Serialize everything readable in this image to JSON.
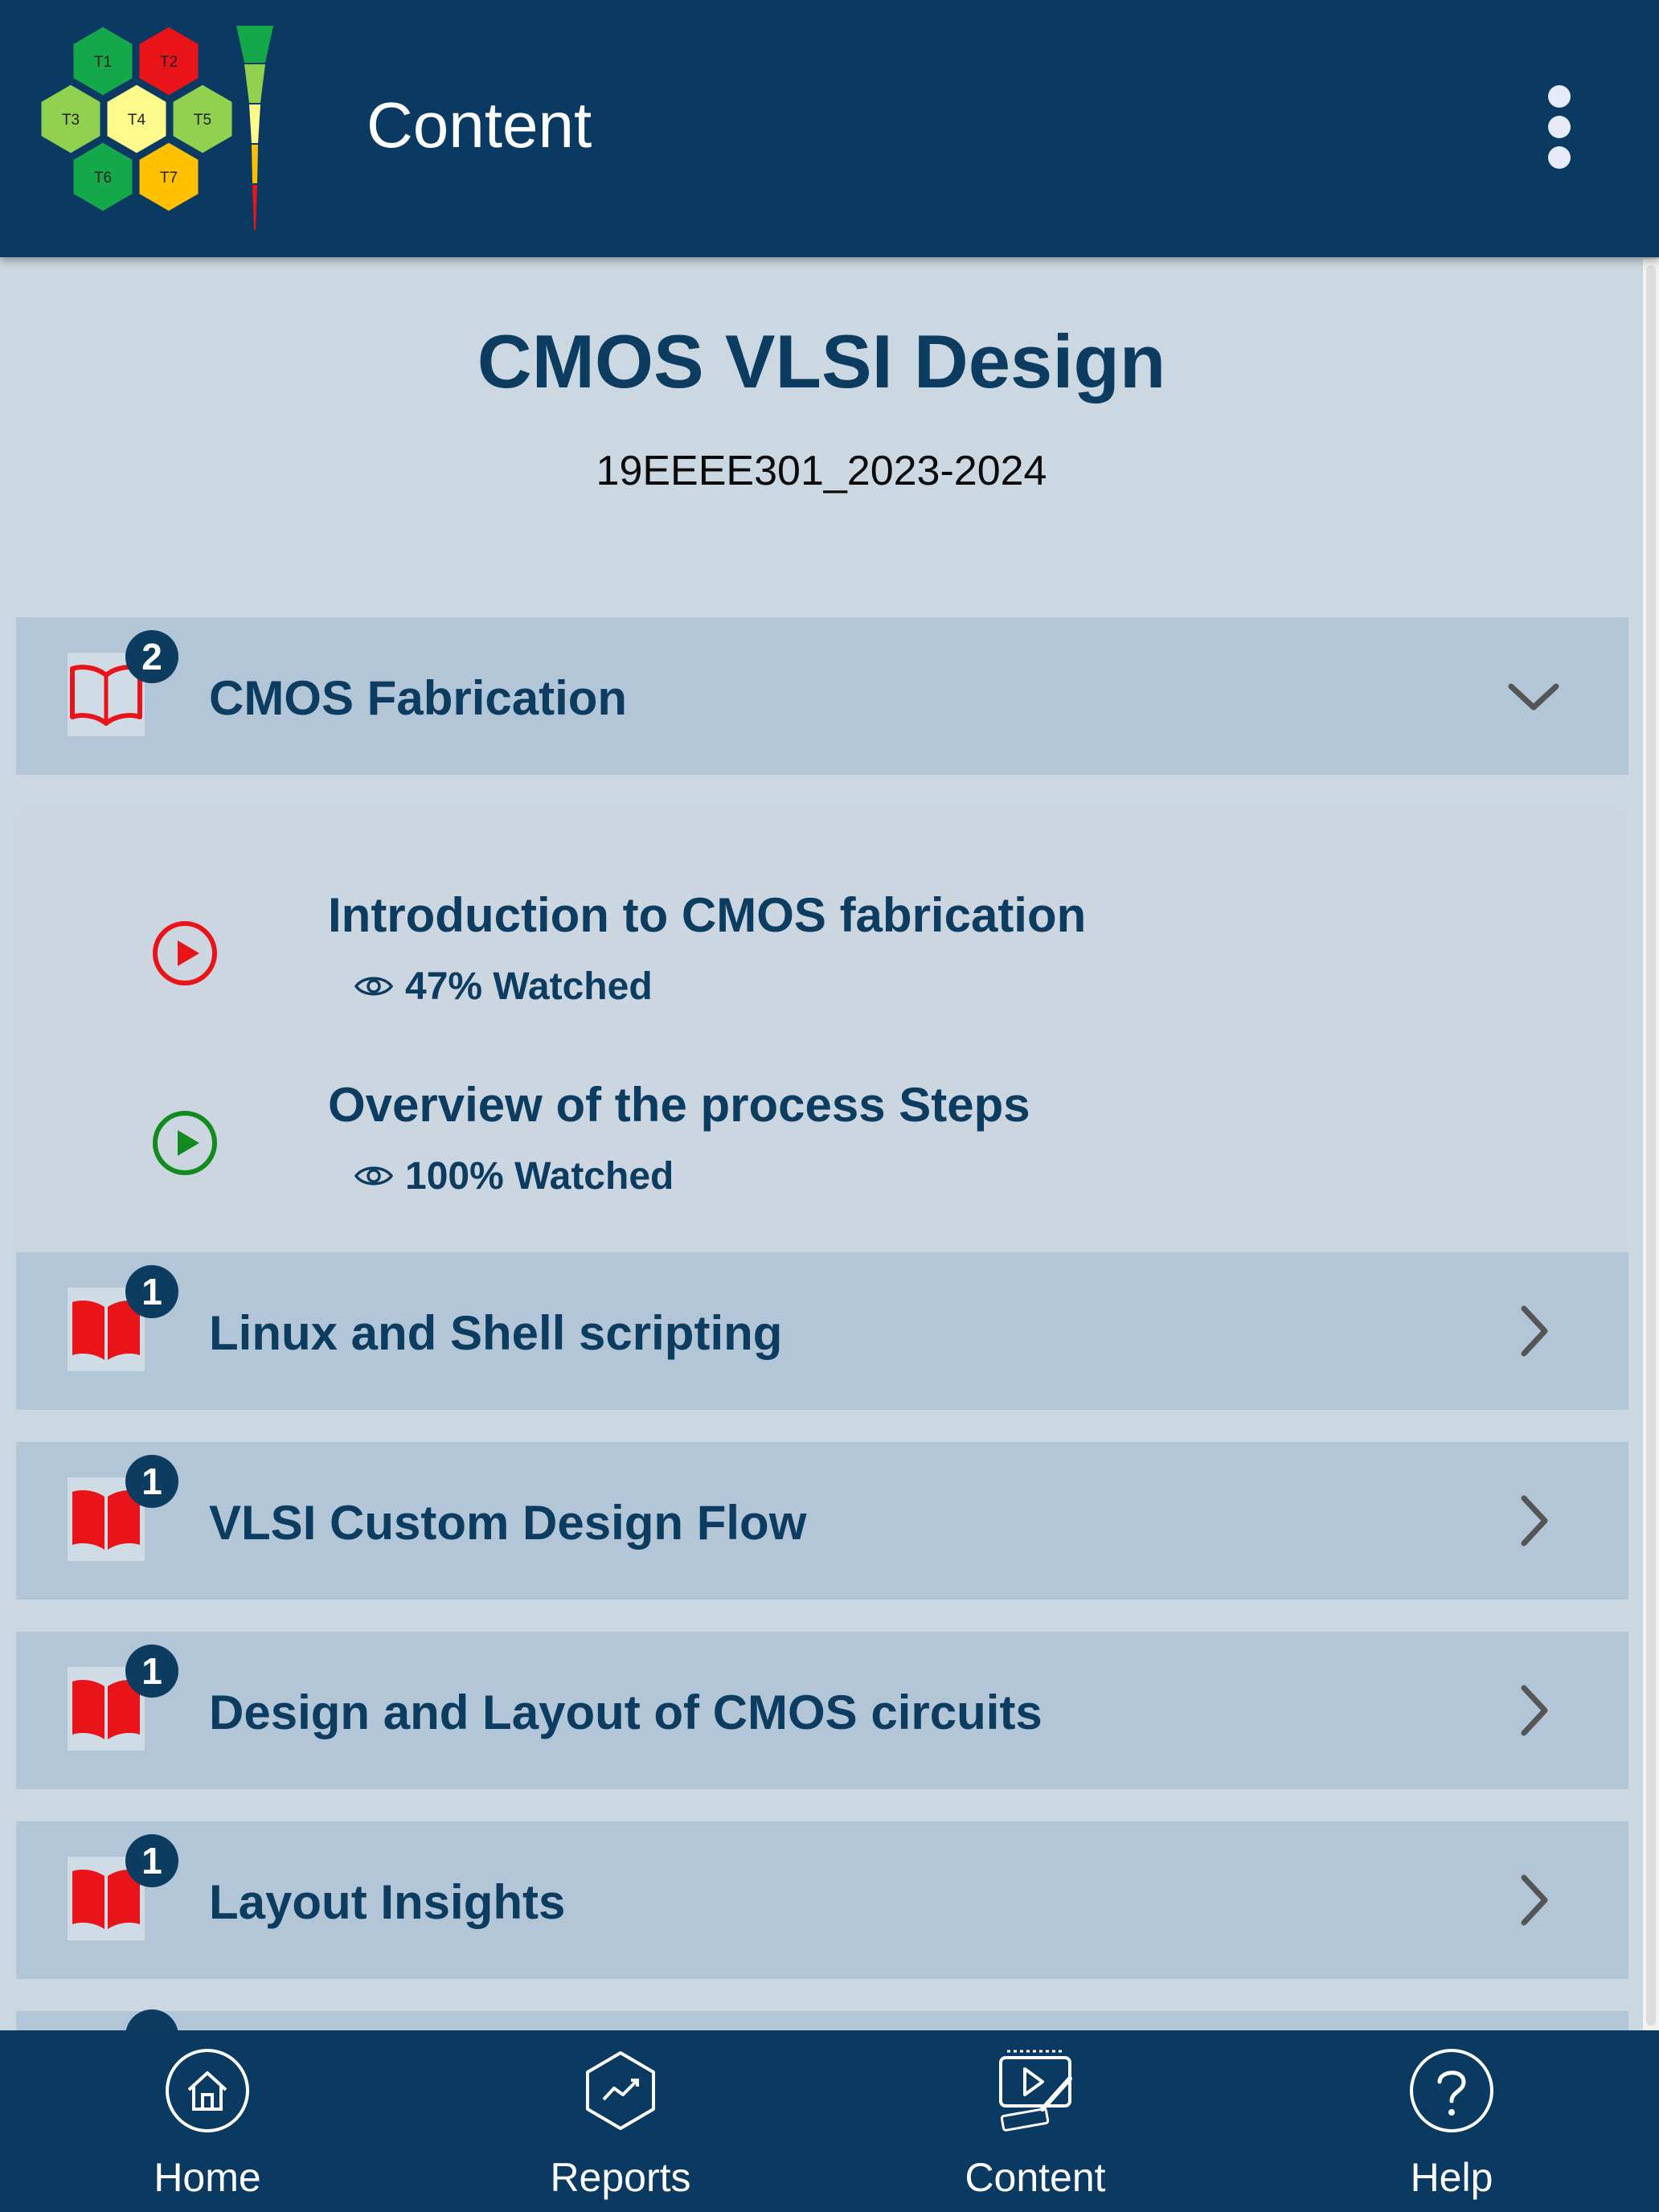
{
  "header": {
    "title": "Content",
    "logo_tiles": [
      "T1",
      "T2",
      "T3",
      "T4",
      "T5",
      "T6",
      "T7"
    ],
    "logo_tile_colors": [
      "#14a84a",
      "#e8141a",
      "#92d050",
      "#fffa8c",
      "#92d050",
      "#14a84a",
      "#ffc000"
    ]
  },
  "course": {
    "title": "CMOS VLSI Design",
    "code": "19EEEE301_2023-2024"
  },
  "sections": [
    {
      "label": "CMOS Fabrication",
      "count": "2",
      "expanded": true,
      "icon": "open-book-outline-icon",
      "videos": [
        {
          "title": "Introduction to CMOS fabrication",
          "watched": "47% Watched",
          "status_color": "#e8141a"
        },
        {
          "title": "Overview of the process Steps",
          "watched": "100% Watched",
          "status_color": "#128a1d"
        }
      ]
    },
    {
      "label": "Linux and Shell scripting",
      "count": "1",
      "expanded": false,
      "icon": "open-book-filled-icon"
    },
    {
      "label": "VLSI Custom Design Flow",
      "count": "1",
      "expanded": false,
      "icon": "open-book-filled-icon"
    },
    {
      "label": "Design and Layout of CMOS circuits",
      "count": "1",
      "expanded": false,
      "icon": "open-book-filled-icon"
    },
    {
      "label": "Layout Insights",
      "count": "1",
      "expanded": false,
      "icon": "open-book-filled-icon"
    }
  ],
  "bottom_nav": [
    {
      "label": "Home",
      "icon": "home-icon"
    },
    {
      "label": "Reports",
      "icon": "reports-icon"
    },
    {
      "label": "Content",
      "icon": "content-icon"
    },
    {
      "label": "Help",
      "icon": "help-icon"
    }
  ],
  "colors": {
    "header_bg": "#0a3a61",
    "page_bg": "#ccd8e1",
    "section_bg": "#b2c6d8",
    "text_primary": "#0d3c61",
    "book_red": "#e8141a"
  }
}
